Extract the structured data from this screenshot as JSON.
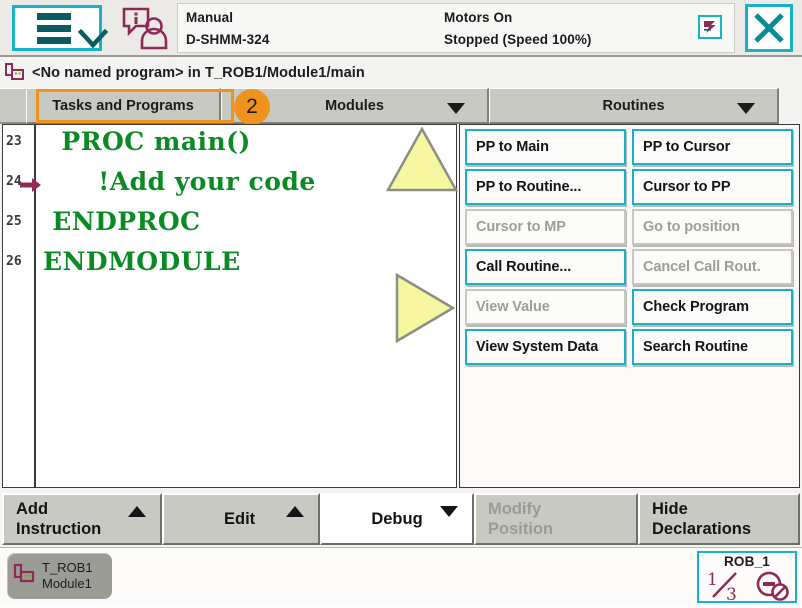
{
  "header": {
    "menu_icon": "hamburger-menu-icon",
    "chevron_icon": "chevron-down-icon",
    "operator_icon": "operator-info-icon",
    "mode_label": "Manual",
    "controller_name": "D-SHMM-324",
    "motors_label": "Motors On",
    "exec_state": "Stopped (Speed 100%)",
    "rapid_icon": "rapid-execution-icon",
    "close_icon": "close-icon",
    "accent_cyan": "#16b3c4",
    "accent_orange": "#f0921e"
  },
  "title": {
    "program_icon": "program-module-icon",
    "text": "<No named program> in T_ROB1/Module1/main"
  },
  "tabs": [
    {
      "label": "Tasks and Programs",
      "caret": false
    },
    {
      "label": "Modules",
      "caret": true
    },
    {
      "label": "Routines",
      "caret": true
    }
  ],
  "annotation": {
    "badge_number": "2",
    "up_arrow_icon": "yellow-up-triangle-icon",
    "right_arrow_icon": "yellow-right-triangle-icon",
    "highlight_color": "#f0921e"
  },
  "editor": {
    "pp_marker_icon": "program-pointer-arrow-icon",
    "lines": [
      {
        "num": "23",
        "code": "  PROC main()",
        "pp": false
      },
      {
        "num": "24",
        "code": "      !Add your code",
        "pp": true
      },
      {
        "num": "25",
        "code": " ENDPROC",
        "pp": false
      },
      {
        "num": "26",
        "code": "ENDMODULE",
        "pp": false
      }
    ],
    "code_color": "#0a8a23"
  },
  "debug_panel": {
    "buttons": [
      {
        "label": "PP to Main",
        "enabled": true
      },
      {
        "label": "PP to Cursor",
        "enabled": true
      },
      {
        "label": "PP to Routine...",
        "enabled": true
      },
      {
        "label": "Cursor to PP",
        "enabled": true
      },
      {
        "label": "Cursor to MP",
        "enabled": false
      },
      {
        "label": "Go to position",
        "enabled": false
      },
      {
        "label": "Call Routine...",
        "enabled": true
      },
      {
        "label": "Cancel Call Rout.",
        "enabled": false
      },
      {
        "label": "View Value",
        "enabled": false
      },
      {
        "label": "Check Program",
        "enabled": true
      },
      {
        "label": "View System Data",
        "enabled": true
      },
      {
        "label": "Search Routine",
        "enabled": true
      }
    ]
  },
  "toolbar": {
    "buttons": [
      {
        "label": "Add\nInstruction",
        "caret": "up",
        "enabled": true,
        "active": false
      },
      {
        "label": "Edit",
        "caret": "up",
        "enabled": true,
        "active": false
      },
      {
        "label": "Debug",
        "caret": "down",
        "enabled": true,
        "active": true
      },
      {
        "label": "Modify\nPosition",
        "caret": "none",
        "enabled": false,
        "active": false
      },
      {
        "label": "Hide\nDeclarations",
        "caret": "none",
        "enabled": true,
        "active": false
      }
    ]
  },
  "taskbar": {
    "task_icon": "program-module-icon",
    "task_label": "T_ROB1\nModule1",
    "robot_name": "ROB_1",
    "jog_fraction": "1/3",
    "jog_numerator": "1",
    "jog_denominator": "3",
    "jog_icon": "jog-disabled-icon"
  }
}
